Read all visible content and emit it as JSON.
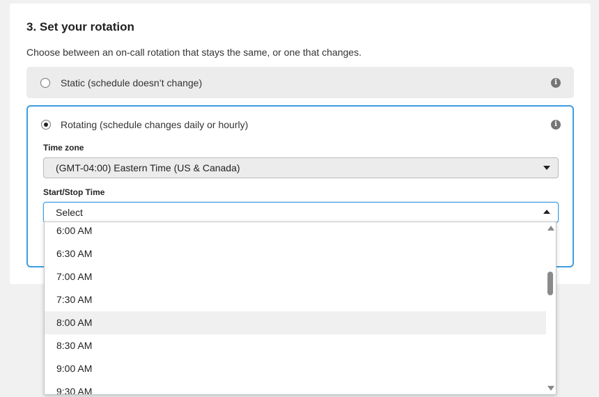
{
  "section": {
    "title": "3. Set your rotation",
    "subtitle": "Choose between an on-call rotation that stays the same, or one that changes."
  },
  "options": {
    "static": {
      "label": "Static (schedule doesn’t change)",
      "selected": false,
      "info_icon": "info-icon"
    },
    "rotating": {
      "label": "Rotating (schedule changes daily or hourly)",
      "selected": true,
      "info_icon": "info-icon"
    }
  },
  "info_glyph": "i",
  "timezone": {
    "label": "Time zone",
    "value": "(GMT-04:00) Eastern Time (US & Canada)"
  },
  "start_stop": {
    "label": "Start/Stop Time",
    "value": "Select",
    "open": true,
    "options": [
      "6:00 AM",
      "6:30 AM",
      "7:00 AM",
      "7:30 AM",
      "8:00 AM",
      "8:30 AM",
      "9:00 AM",
      "9:30 AM"
    ],
    "hovered_index": 4
  },
  "colors": {
    "accent": "#3d9de0",
    "page_bg": "#f1f1f1",
    "static_bg": "#ececec"
  }
}
